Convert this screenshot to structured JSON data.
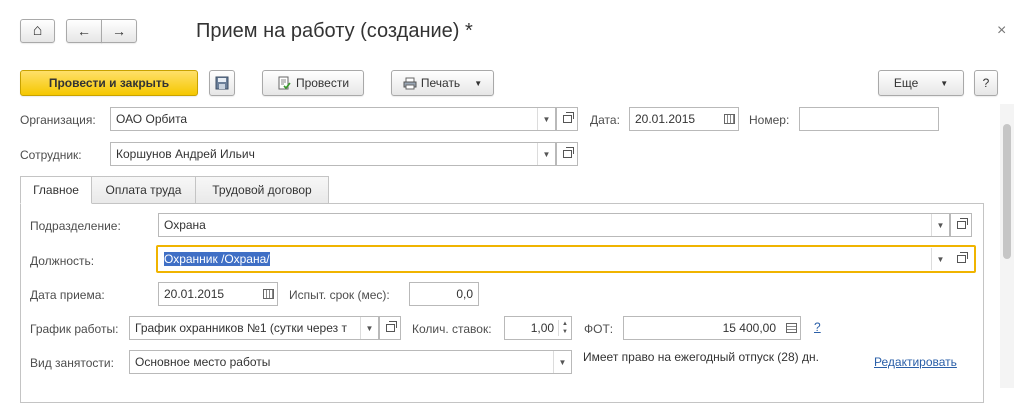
{
  "window": {
    "title": "Прием на работу (создание) *",
    "close_glyph": "×",
    "home_glyph": "⌂",
    "back_glyph": "←",
    "forward_glyph": "→"
  },
  "toolbar": {
    "post_close_label": "Провести и закрыть",
    "post_label": "Провести",
    "print_label": "Печать",
    "more_label": "Еще",
    "help_label": "?"
  },
  "header": {
    "organization_label": "Организация:",
    "organization_value": "ОАО Орбита",
    "date_label": "Дата:",
    "date_value": "20.01.2015",
    "number_label": "Номер:",
    "number_value": "",
    "employee_label": "Сотрудник:",
    "employee_value": "Коршунов Андрей Ильич"
  },
  "tabs": [
    {
      "label": "Главное"
    },
    {
      "label": "Оплата труда"
    },
    {
      "label": "Трудовой договор"
    }
  ],
  "main": {
    "department_label": "Подразделение:",
    "department_value": "Охрана",
    "position_label": "Должность:",
    "position_value": "Охранник /Охрана/",
    "hire_date_label": "Дата приема:",
    "hire_date_value": "20.01.2015",
    "probation_label": "Испыт. срок (мес):",
    "probation_value": "0,0",
    "schedule_label": "График работы:",
    "schedule_value": "График охранников №1 (сутки через т",
    "rates_label": "Колич. ставок:",
    "rates_value": "1,00",
    "payroll_label": "ФОТ:",
    "payroll_value": "15 400,00",
    "payroll_help": "?",
    "employment_label": "Вид занятости:",
    "employment_value": "Основное место работы",
    "vacation_text": "Имеет право на ежегодный отпуск (28) дн.",
    "edit_link": "Редактировать"
  },
  "colors": {
    "primary_button": "#f5c800",
    "focus_border": "#f0b400",
    "selection": "#3f6fc5",
    "link": "#2a5fa8"
  }
}
